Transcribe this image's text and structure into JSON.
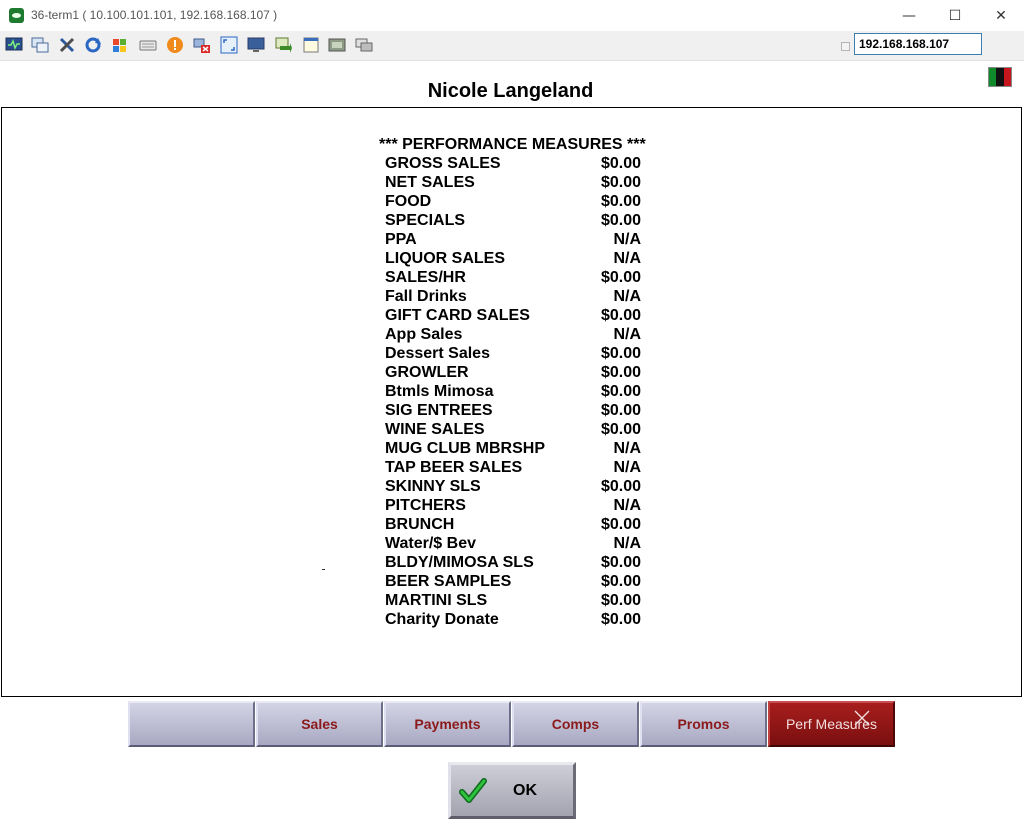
{
  "window": {
    "title": "36-term1 ( 10.100.101.101, 192.168.168.107 )"
  },
  "toolbar": {
    "ip_address": "192.168.168.107",
    "icons": [
      "monitor-icon",
      "windows-icon",
      "tools-icon",
      "refresh-icon",
      "winlogo-icon",
      "keyboard-icon",
      "alert-icon",
      "disconnect-icon",
      "fullscreen-icon",
      "screen-icon",
      "transfer-icon",
      "notes-icon",
      "camera-icon",
      "chat-icon"
    ]
  },
  "employee": {
    "name": "Nicole Langeland"
  },
  "report": {
    "heading": "*** PERFORMANCE MEASURES ***",
    "rows": [
      {
        "label": "GROSS SALES",
        "value": "$0.00"
      },
      {
        "label": "NET SALES",
        "value": "$0.00"
      },
      {
        "label": "FOOD",
        "value": "$0.00"
      },
      {
        "label": "SPECIALS",
        "value": "$0.00"
      },
      {
        "label": "PPA",
        "value": "N/A"
      },
      {
        "label": "LIQUOR SALES",
        "value": "N/A"
      },
      {
        "label": "SALES/HR",
        "value": "$0.00"
      },
      {
        "label": "Fall Drinks",
        "value": "N/A"
      },
      {
        "label": "GIFT CARD SALES",
        "value": "$0.00"
      },
      {
        "label": "App Sales",
        "value": "N/A"
      },
      {
        "label": "Dessert Sales",
        "value": "$0.00"
      },
      {
        "label": "GROWLER",
        "value": "$0.00"
      },
      {
        "label": "Btmls Mimosa",
        "value": "$0.00"
      },
      {
        "label": "SIG ENTREES",
        "value": "$0.00"
      },
      {
        "label": "WINE SALES",
        "value": "$0.00"
      },
      {
        "label": "MUG CLUB MBRSHP",
        "value": "N/A"
      },
      {
        "label": "TAP BEER SALES",
        "value": "N/A"
      },
      {
        "label": "SKINNY SLS",
        "value": "$0.00"
      },
      {
        "label": "PITCHERS",
        "value": "N/A"
      },
      {
        "label": "BRUNCH",
        "value": "$0.00"
      },
      {
        "label": "Water/$ Bev",
        "value": "N/A"
      },
      {
        "label": "BLDY/MIMOSA SLS",
        "value": "$0.00"
      },
      {
        "label": "BEER SAMPLES",
        "value": "$0.00"
      },
      {
        "label": "MARTINI SLS",
        "value": "$0.00"
      },
      {
        "label": "Charity Donate",
        "value": "$0.00"
      }
    ]
  },
  "tabs": [
    {
      "label": ""
    },
    {
      "label": "Sales"
    },
    {
      "label": "Payments"
    },
    {
      "label": "Comps"
    },
    {
      "label": "Promos"
    },
    {
      "label": "Perf Measures",
      "active": true
    }
  ],
  "ok_button": {
    "label": "OK"
  },
  "colors": {
    "tab_text": "#8b1a1a",
    "active_tab": "#9a1616",
    "panel_border": "#000000"
  }
}
